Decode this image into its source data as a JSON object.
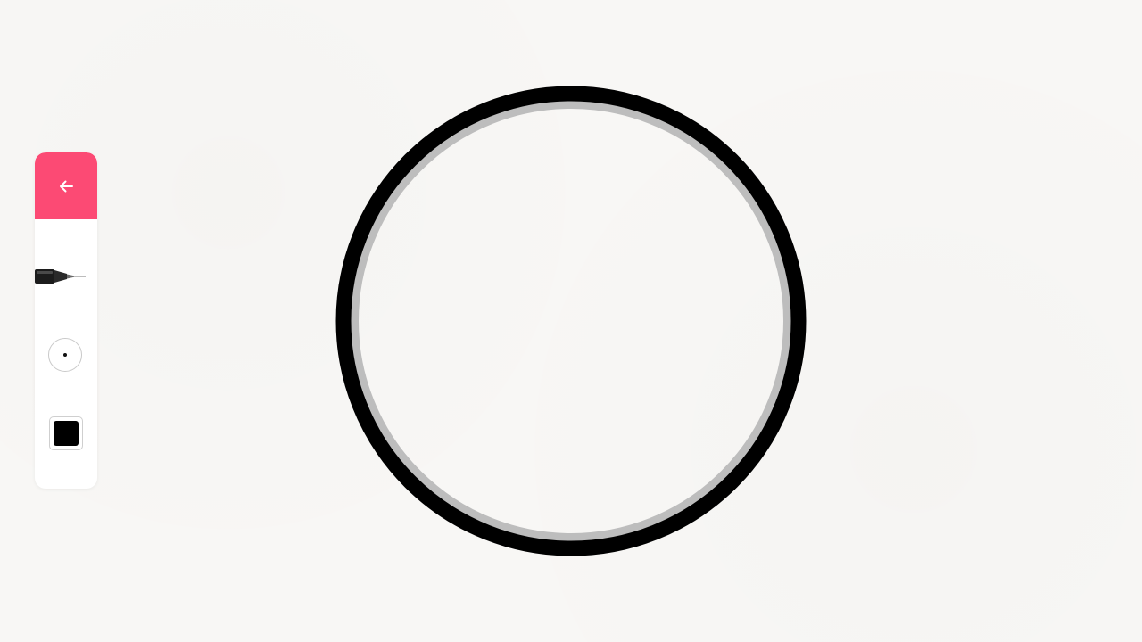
{
  "colors": {
    "background": "#f8f7f5",
    "accent": "#fc4a74",
    "toolbar_bg": "#ffffff",
    "selected_color": "#000000",
    "outer_ring": "#000000",
    "inner_ring": "#bdbdbd"
  },
  "toolbar": {
    "back_icon": "arrow-left-icon",
    "tool_icon": "pen-icon",
    "brush_icon": "brush-size-icon",
    "color_icon": "color-swatch"
  },
  "drawing": {
    "shape": "circle",
    "rings": [
      "outer-ring",
      "inner-ring"
    ]
  }
}
